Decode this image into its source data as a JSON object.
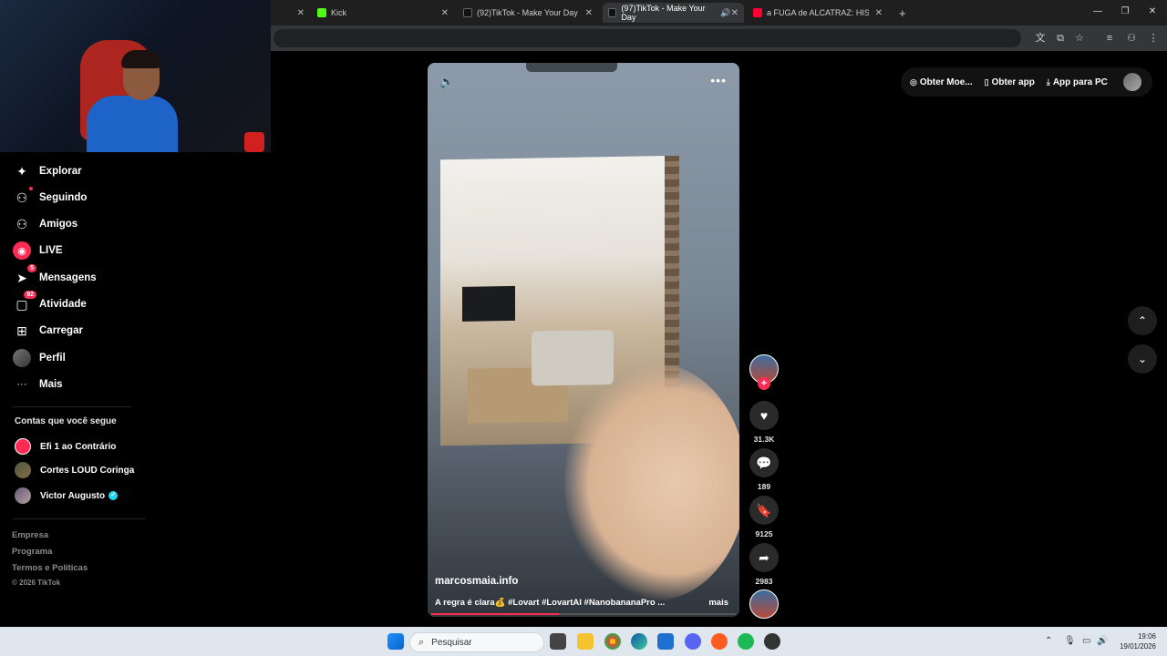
{
  "browser": {
    "tabs": [
      {
        "label": "",
        "active": false
      },
      {
        "label": "Kick",
        "active": false
      },
      {
        "label": "(92)TikTok - Make Your Day",
        "active": false
      },
      {
        "label": "(97)TikTok - Make Your Day",
        "active": true
      },
      {
        "label": "a FUGA de ALCATRAZ: HISTÓRI",
        "active": false
      }
    ],
    "new_tab": "+"
  },
  "sidebar": {
    "items": [
      {
        "label": "Explorar",
        "icon": "compass-icon",
        "glyph": "✦"
      },
      {
        "label": "Seguindo",
        "icon": "user-follow-icon",
        "glyph": "⚇"
      },
      {
        "label": "Amigos",
        "icon": "friends-icon",
        "glyph": "⚇"
      },
      {
        "label": "LIVE",
        "icon": "live-icon",
        "glyph": "◉"
      },
      {
        "label": "Mensagens",
        "icon": "messages-icon",
        "glyph": "➤",
        "badge": "5"
      },
      {
        "label": "Atividade",
        "icon": "activity-icon",
        "glyph": "▢",
        "badge": "92"
      },
      {
        "label": "Carregar",
        "icon": "upload-icon",
        "glyph": "⊞"
      },
      {
        "label": "Perfil",
        "icon": "profile-icon",
        "glyph": "●"
      },
      {
        "label": "Mais",
        "icon": "more-icon",
        "glyph": "···"
      }
    ],
    "following_title": "Contas que você segue",
    "following": [
      {
        "name": "Efi 1 ao Contrário",
        "verified": false
      },
      {
        "name": "Cortes LOUD Coringa",
        "verified": false
      },
      {
        "name": "Victor Augusto",
        "verified": true
      }
    ],
    "footer": [
      "Empresa",
      "Programa",
      "Termos e Políticas",
      "© 2026 TikTok"
    ]
  },
  "video": {
    "author": "marcosmaia.info",
    "caption": "A regra é clara💰 #Lovart #LovartAI #NanobananaPro ...",
    "more_label": "mais",
    "progress": 0.42
  },
  "actions": {
    "likes": "31.3K",
    "comments": "189",
    "saves": "9125",
    "shares": "2983"
  },
  "topright": {
    "coins": "Obter Moe...",
    "app": "Obter app",
    "pc_app": "App para PC"
  },
  "taskbar": {
    "search_placeholder": "Pesquisar",
    "time": "19:06",
    "date": "19/01/2026"
  },
  "colors": {
    "accent": "#fe2c55",
    "verified": "#20d5ec"
  }
}
